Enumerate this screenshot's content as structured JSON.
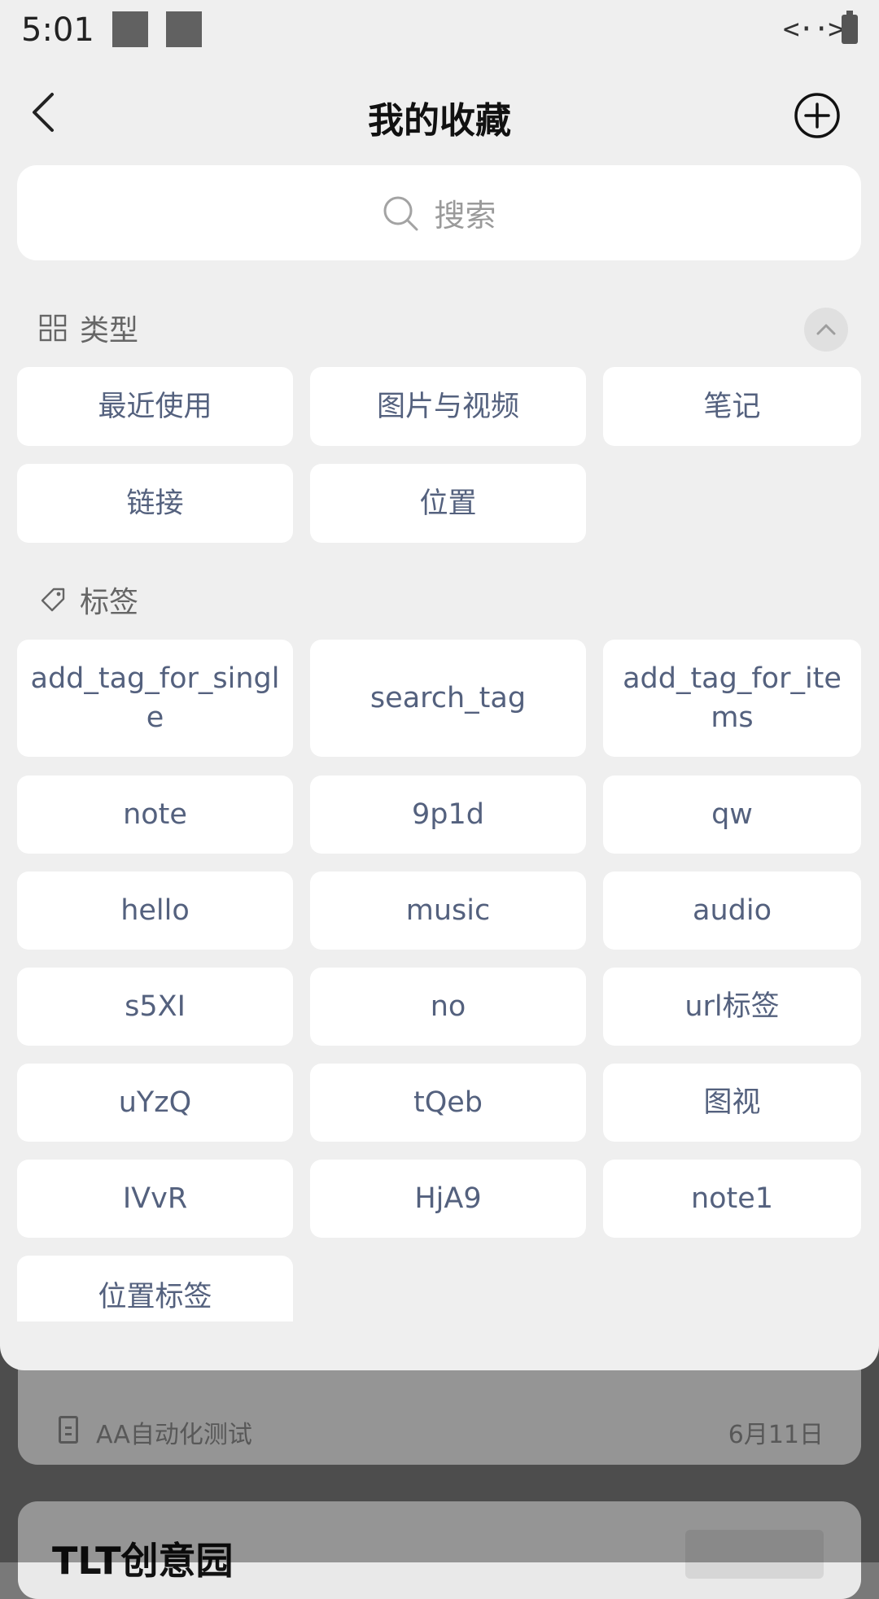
{
  "status_bar": {
    "time": "5:01",
    "code_icon_text": "<··>"
  },
  "header": {
    "title": "我的收藏",
    "back_icon": "chevron-left-icon",
    "add_icon": "plus-circle-icon"
  },
  "search": {
    "placeholder": "搜索",
    "icon": "search-icon"
  },
  "types_section": {
    "label": "类型",
    "icon": "grid-icon",
    "items": [
      "最近使用",
      "图片与视频",
      "笔记",
      "链接",
      "位置"
    ]
  },
  "tags_section": {
    "label": "标签",
    "icon": "tag-icon",
    "items": [
      "add_tag_for_single",
      "search_tag",
      "add_tag_for_items",
      "note",
      "9p1d",
      "qw",
      "hello",
      "music",
      "audio",
      "s5XI",
      "no",
      "url标签",
      "uYzQ",
      "tQeb",
      "图视",
      "IVvR",
      "HjA9",
      "note1",
      "位置标签"
    ]
  },
  "background": {
    "item_title": "AA自动化测试",
    "item_date": "6月11日",
    "card2_title": "TLT创意园"
  },
  "colors": {
    "chip_text": "#54617e",
    "sheet_bg": "#efefef"
  }
}
